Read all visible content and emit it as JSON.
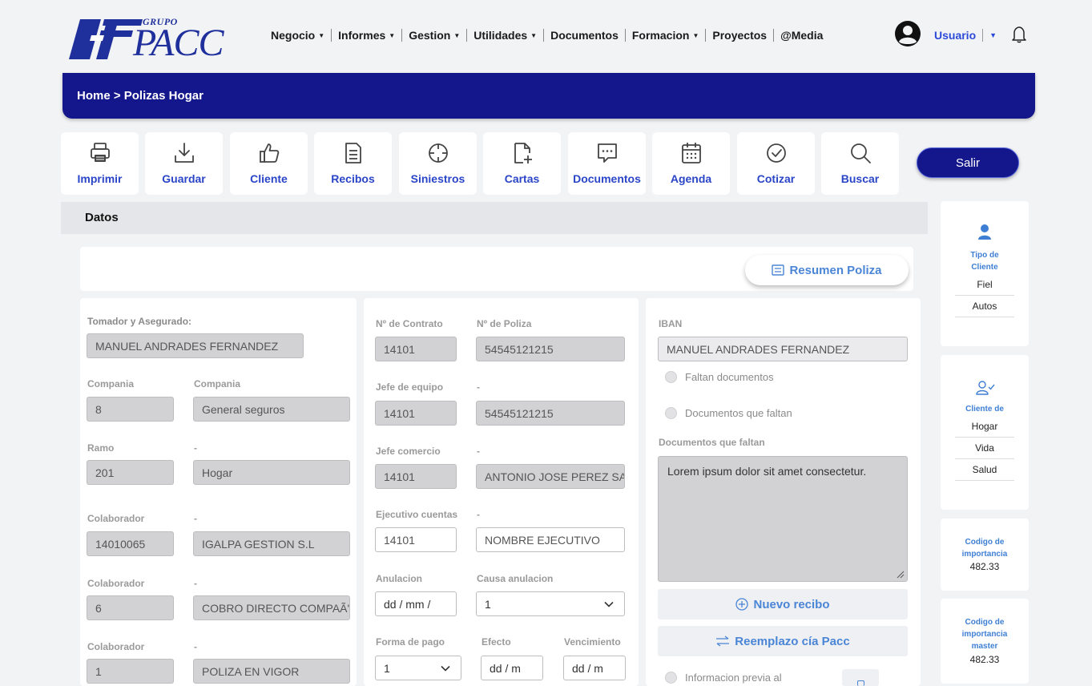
{
  "brand": {
    "grupo": "GRUPO",
    "name": "PACC"
  },
  "nav": {
    "items": [
      {
        "label": "Negocio",
        "caret": true
      },
      {
        "label": "Informes",
        "caret": true
      },
      {
        "label": "Gestion",
        "caret": true
      },
      {
        "label": "Utilidades",
        "caret": true
      },
      {
        "label": "Documentos",
        "caret": false
      },
      {
        "label": "Formacion",
        "caret": true
      },
      {
        "label": "Proyectos",
        "caret": false
      },
      {
        "label": "@Media",
        "caret": false
      }
    ],
    "user_label": "Usuario"
  },
  "breadcrumb": "Home > Polizas Hogar",
  "toolbar": {
    "items": [
      "Imprimir",
      "Guardar",
      "Cliente",
      "Recibos",
      "Siniestros",
      "Cartas",
      "Documentos",
      "Agenda",
      "Cotizar",
      "Buscar"
    ],
    "exit_label": "Salir"
  },
  "section_title": "Datos",
  "resumen_label": "Resumen Poliza",
  "left": {
    "tomador_label": "Tomador y Asegurado:",
    "tomador_value": "MANUEL ANDRADES FERNANDEZ",
    "compania_label1": "Compania",
    "compania_label2": "Compania",
    "compania_code": "8",
    "compania_name": "General seguros",
    "ramo_label": "Ramo",
    "ramo_dash": "-",
    "ramo_code": "201",
    "ramo_name": "Hogar",
    "colab1_label": "Colaborador",
    "colab1_dash": "-",
    "colab1_code": "14010065",
    "colab1_name": "IGALPA GESTION S.L",
    "colab2_label": "Colaborador",
    "colab2_dash": "-",
    "colab2_code": "6",
    "colab2_name": "COBRO DIRECTO COMPAÃ'I",
    "colab3_label": "Colaborador",
    "colab3_dash": "-",
    "colab3_code": "1",
    "colab3_name": "POLIZA EN VIGOR"
  },
  "middle": {
    "contrato_label": "Nº de Contrato",
    "poliza_label": "Nº de Poliza",
    "contrato_value": "14101",
    "poliza_value": "54545121215",
    "jefe_equipo_label": "Jefe de equipo",
    "jefe_equipo_dash": "-",
    "jefe_equipo_code": "14101",
    "jefe_equipo_value": "54545121215",
    "jefe_comercio_label": "Jefe comercio",
    "jefe_comercio_dash": "-",
    "jefe_comercio_code": "14101",
    "jefe_comercio_value": "ANTONIO JOSE PEREZ SAN",
    "ejecutivo_label": "Ejecutivo cuentas",
    "ejecutivo_dash": "-",
    "ejecutivo_code": "14101",
    "ejecutivo_value": "NOMBRE EJECUTIVO",
    "anulacion_label": "Anulacion",
    "causa_label": "Causa anulacion",
    "anulacion_placeholder": "dd / mm /",
    "causa_value": "1",
    "forma_pago_label": "Forma de pago",
    "efecto_label": "Efecto",
    "vencimiento_label": "Vencimiento",
    "forma_pago_value": "1",
    "efecto_placeholder": "dd / m",
    "vencimiento_placeholder": "dd / m"
  },
  "right": {
    "iban_label": "IBAN",
    "iban_value": "MANUEL ANDRADES FERNANDEZ",
    "radio1": "Faltan documentos",
    "radio2": "Documentos que faltan",
    "docs_label": "Documentos que faltan",
    "docs_text": "Lorem ipsum dolor sit amet consectetur.",
    "nuevo_recibo": "Nuevo recibo",
    "reemplazo": "Reemplazo cía Pacc",
    "info_previa": "Informacion previa al"
  },
  "sidebar": {
    "card1_title_1": "Tipo de",
    "card1_title_2": "Cliente",
    "card1_values": [
      "Fiel",
      "Autos"
    ],
    "card2_title": "Cliente de",
    "card2_values": [
      "Hogar",
      "Vida",
      "Salud"
    ],
    "card3_title_1": "Codigo de",
    "card3_title_2": "importancia",
    "card3_value": "482.33",
    "card4_title_1": "Codigo de",
    "card4_title_2": "importancia",
    "card4_title_3": "master",
    "card4_value": "482.33"
  }
}
